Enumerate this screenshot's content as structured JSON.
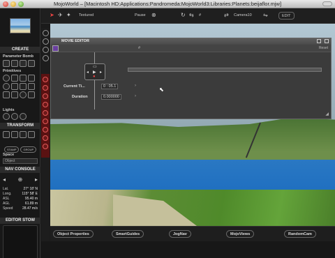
{
  "window": {
    "title": "MojoWorld – [Macintosh HD:Applications:Pandromeda:MojoWorld3:Libraries:Planets:beijaflor.mjw]"
  },
  "toolbar": {
    "textured": "Textured",
    "pause": "Pause",
    "camera": "Camera10",
    "edit": "EDIT",
    "hash1": "#",
    "hash2": "#"
  },
  "left": {
    "create": "CREATE",
    "param_bomb": "Parameter Bomb",
    "primitives": "Primitives",
    "lights": "Lights",
    "transform": "TRANSFORM",
    "stamp": "STAMP",
    "group": "GROUP",
    "space": "Space",
    "space_value": "Object",
    "nav_console": "NAV CONSOLE",
    "readouts": [
      {
        "k": "Lat.",
        "v": "27° 18' N"
      },
      {
        "k": "Long.",
        "v": "115° 58' E"
      },
      {
        "k": "ASL",
        "v": "95.40 m"
      },
      {
        "k": "AGL",
        "v": "61.89 m"
      },
      {
        "k": "Speed",
        "v": "28.47 m/s"
      }
    ],
    "editor_stow": "EDITOR STOW"
  },
  "movie": {
    "title": "MOVIE EDITOR",
    "hash": "#",
    "reset": "Reset",
    "current_time_label": "Current Ti...",
    "current_time_value": "0 : 05.1",
    "duration_label": "Duration",
    "duration_value": "0.000000"
  },
  "bottom": {
    "object_properties": "Object Properties",
    "smartguides": "SmartGuides",
    "jognav": "JogNav",
    "mojoviews": "MojoViews",
    "randomcam": "RandomCam"
  }
}
